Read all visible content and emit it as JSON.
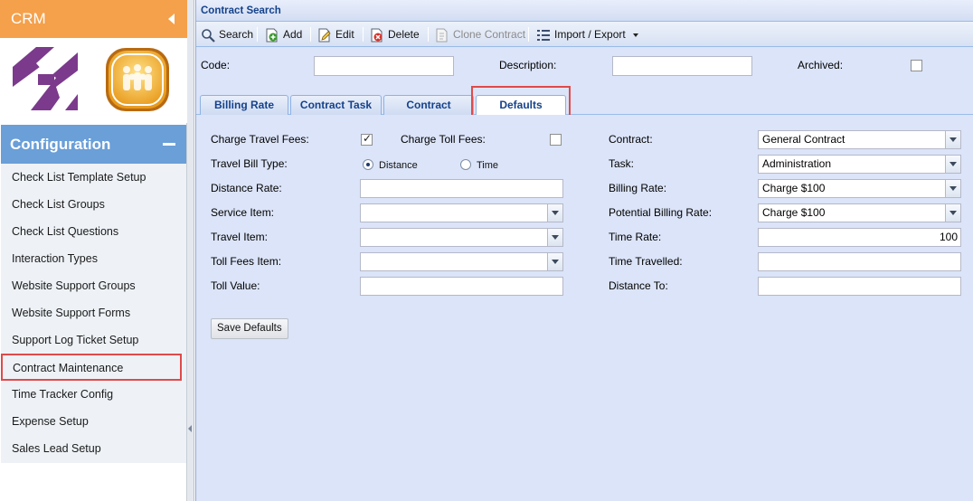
{
  "sidebar": {
    "app_title": "CRM",
    "section_title": "Configuration",
    "menu_items": [
      {
        "label": "Check List Template Setup"
      },
      {
        "label": "Check List Groups"
      },
      {
        "label": "Check List Questions"
      },
      {
        "label": "Interaction Types"
      },
      {
        "label": "Website Support Groups"
      },
      {
        "label": "Website Support Forms"
      },
      {
        "label": "Support Log Ticket Setup"
      },
      {
        "label": "Contract Maintenance",
        "highlighted": true
      },
      {
        "label": "Time Tracker Config"
      },
      {
        "label": "Expense Setup"
      },
      {
        "label": "Sales Lead Setup"
      }
    ]
  },
  "panel": {
    "title": "Contract Search"
  },
  "toolbar": {
    "search": "Search",
    "add": "Add",
    "edit": "Edit",
    "delete": "Delete",
    "clone": "Clone Contract",
    "import_export": "Import / Export"
  },
  "search_form": {
    "code_label": "Code:",
    "code_value": "",
    "description_label": "Description:",
    "description_value": "",
    "archived_label": "Archived:",
    "archived_checked": false
  },
  "tabs": [
    {
      "label": "Billing Rate"
    },
    {
      "label": "Contract Task"
    },
    {
      "label": "Contract"
    },
    {
      "label": "Defaults",
      "active": true
    }
  ],
  "defaults": {
    "charge_travel_fees_label": "Charge Travel Fees:",
    "charge_travel_fees_checked": true,
    "charge_toll_fees_label": "Charge Toll Fees:",
    "charge_toll_fees_checked": false,
    "travel_bill_type_label": "Travel Bill Type:",
    "travel_bill_type_options": [
      "Distance",
      "Time"
    ],
    "travel_bill_type_selected": "Distance",
    "distance_rate_label": "Distance Rate:",
    "distance_rate_value": "",
    "service_item_label": "Service Item:",
    "service_item_value": "",
    "travel_item_label": "Travel Item:",
    "travel_item_value": "",
    "toll_fees_item_label": "Toll Fees Item:",
    "toll_fees_item_value": "",
    "toll_value_label": "Toll Value:",
    "toll_value_value": "",
    "contract_label": "Contract:",
    "contract_value": "General Contract",
    "task_label": "Task:",
    "task_value": "Administration",
    "billing_rate_label": "Billing Rate:",
    "billing_rate_value": "Charge $100",
    "potential_billing_rate_label": "Potential Billing Rate:",
    "potential_billing_rate_value": "Charge $100",
    "time_rate_label": "Time Rate:",
    "time_rate_value": "100",
    "time_travelled_label": "Time Travelled:",
    "time_travelled_value": "",
    "distance_to_label": "Distance To:",
    "distance_to_value": "",
    "save_button": "Save Defaults"
  },
  "colors": {
    "crm_header": "#f5a04a",
    "config_header": "#6a9fd8",
    "highlight_border": "#e04a4a",
    "panel_background": "#dbe4f8",
    "title_text": "#15428b"
  },
  "icons": [
    "search-icon",
    "add-icon",
    "edit-icon",
    "delete-icon",
    "clone-icon",
    "import-export-icon",
    "collapse-arrow-icon",
    "collapse-minus-icon"
  ]
}
